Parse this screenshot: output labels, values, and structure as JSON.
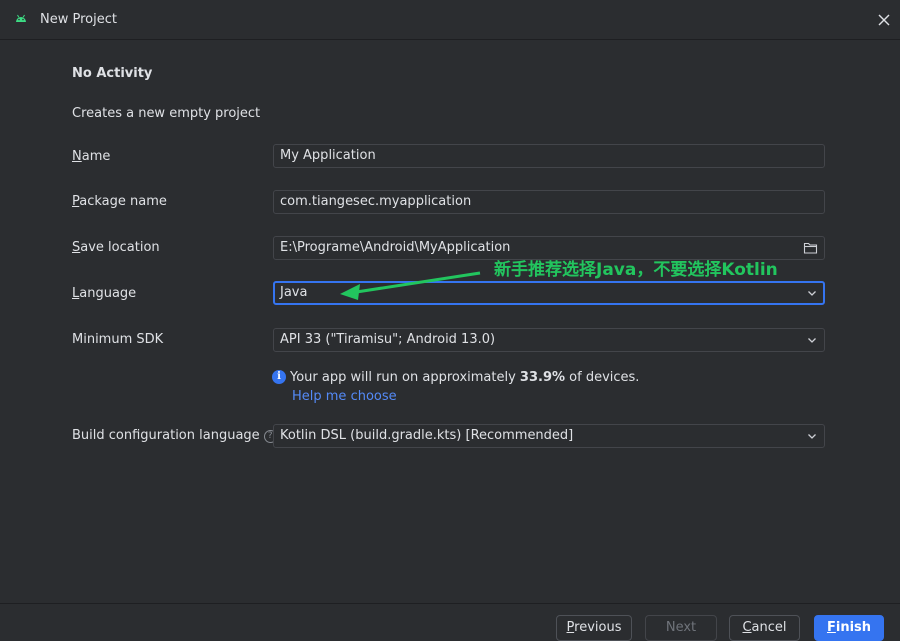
{
  "window": {
    "title": "New Project",
    "app_icon": "android-icon",
    "close_icon": "close-icon"
  },
  "template": {
    "heading": "No Activity",
    "description": "Creates a new empty project"
  },
  "form": {
    "name": {
      "label_mn": "N",
      "label_rest": "ame",
      "value": "My Application"
    },
    "package_name": {
      "label_mn": "P",
      "label_rest": "ackage name",
      "value": "com.tiangesec.myapplication"
    },
    "save_location": {
      "label_mn": "S",
      "label_rest": "ave location",
      "value": "E:\\Programe\\Android\\MyApplication",
      "icon": "folder-icon"
    },
    "language": {
      "label_mn": "L",
      "label_rest": "anguage",
      "value": "Java"
    },
    "minimum_sdk": {
      "label": "Minimum SDK",
      "value": "API 33 (\"Tiramisu\"; Android 13.0)"
    },
    "build_config": {
      "label": "Build configuration language",
      "value": "Kotlin DSL (build.gradle.kts) [Recommended]",
      "help_icon": "question-icon"
    }
  },
  "info": {
    "icon": "info-icon",
    "text_before": "Your app will run on approximately ",
    "percent": "33.9%",
    "text_after": " of devices.",
    "help_link": "Help me choose"
  },
  "annotation": {
    "text": "新手推荐选择Java，不要选择Kotlin",
    "color": "#22c55e"
  },
  "footer": {
    "previous": {
      "mn": "P",
      "rest": "revious"
    },
    "next": "Next",
    "cancel": {
      "mn": "C",
      "rest": "ancel"
    },
    "finish": {
      "mn": "F",
      "rest": "inish"
    }
  },
  "colors": {
    "background": "#2b2d30",
    "accent": "#3574f0",
    "link": "#548af7",
    "text": "#dfe1e5"
  }
}
